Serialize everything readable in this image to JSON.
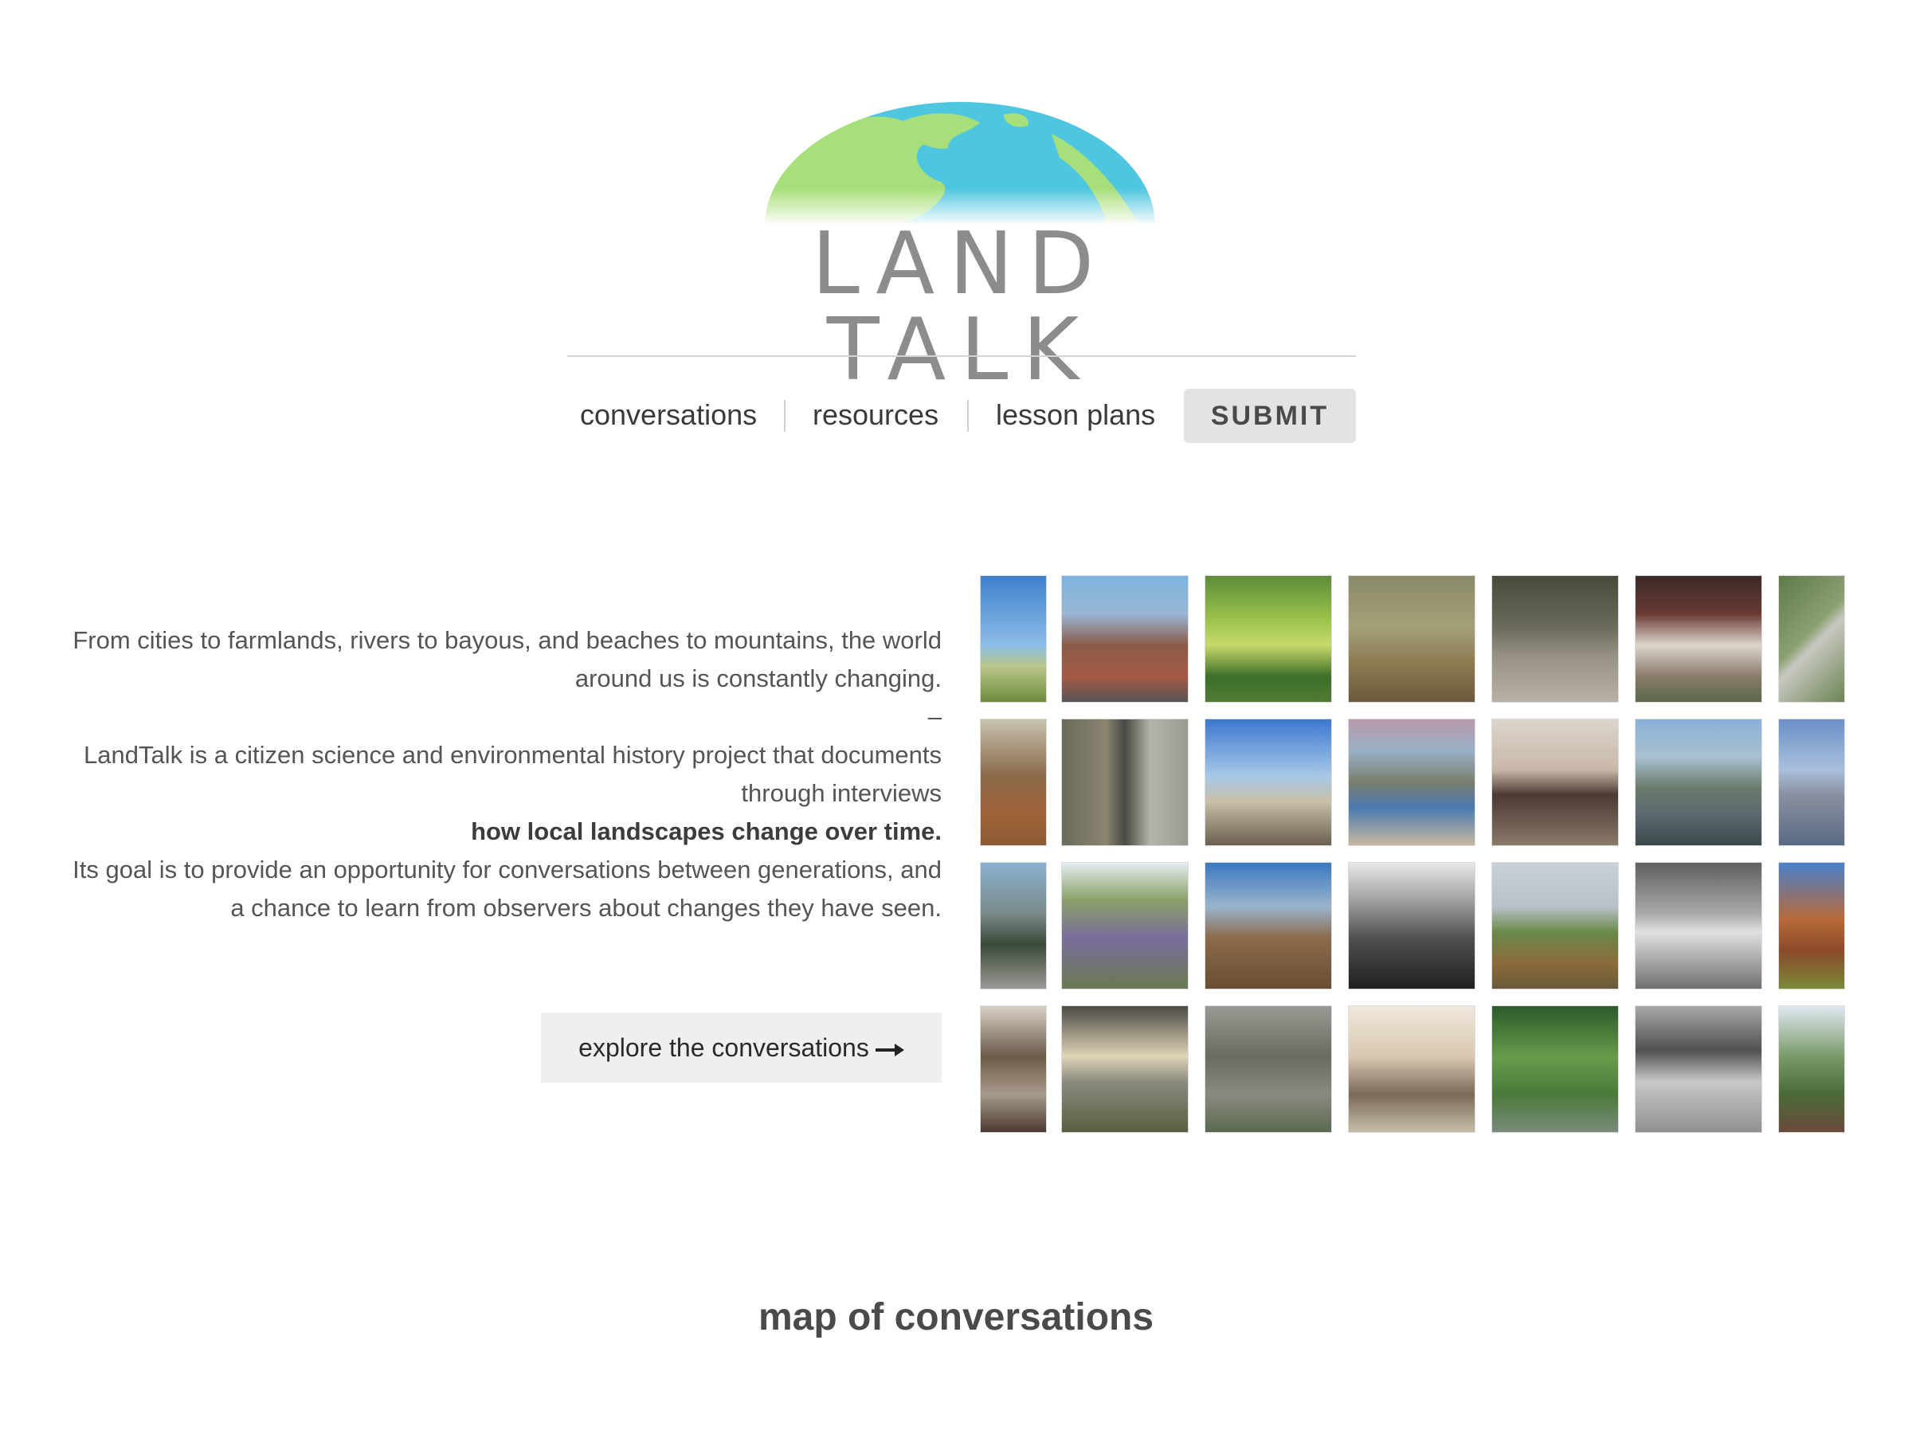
{
  "logo": {
    "text": "LAND TALK",
    "icon": "globe-icon",
    "colors": {
      "ocean": "#4fc6df",
      "land": "#a7df7a",
      "text": "#8c8c8c"
    }
  },
  "nav": {
    "items": [
      {
        "label": "conversations"
      },
      {
        "label": "resources"
      },
      {
        "label": "lesson plans"
      }
    ],
    "submit_label": "SUBMIT"
  },
  "intro": {
    "line1": "From cities to farmlands, rivers to bayous, and beaches to mountains, the world around us is constantly changing.",
    "dash": "–",
    "line2": "LandTalk is a citizen science and environmental history project that documents through interviews",
    "highlight": "how local landscapes change over time.",
    "line3": "Its goal is to provide an opportunity for conversations between generations, and a chance to learn from observers about changes they have seen."
  },
  "explore_button": {
    "label": "explore the conversations"
  },
  "map": {
    "title": "map of conversations"
  },
  "gallery": {
    "rows": [
      [
        {
          "bg": "linear-gradient(to bottom,#3f7fcc 0%,#8cbde8 55%,#b9c78a 72%,#6e8b3d 100%)"
        },
        {
          "bg": "linear-gradient(to bottom,#7cb4e0 0%,#9ab7d4 30%,#8a5a4a 55%,#a45a46 80%,#555 100%)"
        },
        {
          "bg": "linear-gradient(to bottom,#5c8c3a 0%,#9cc44c 35%,#c7d86a 55%,#3e6e2a 80%,#4f7c34 100%)"
        },
        {
          "bg": "linear-gradient(to bottom,#8a8a6a 0%,#a4a078 40%,#8c7a52 70%,#6a5a3a 100%)"
        },
        {
          "bg": "linear-gradient(to bottom,#4a4a3a 0%,#6a6a5a 40%,#9a9488 65%,#b8b0a4 100%)"
        },
        {
          "bg": "linear-gradient(to bottom,#3a2a26 0%,#6a3a34 30%,#ddd6cc 55%,#8a7a6a 80%,#5a6a4a 100%)"
        },
        {
          "bg": "linear-gradient(135deg,#5f7a4a 0%,#8aa070 45%,#c8c8c0 55%,#6a8454 100%)"
        }
      ],
      [
        {
          "bg": "linear-gradient(to bottom,#c8c2b0 0%,#8a6a4a 45%,#a0643a 75%,#8a5a32 100%)"
        },
        {
          "bg": "linear-gradient(to right,#6a6a5a 0%,#8a8470 35%,#4a4a44 50%,#b4b4aa 70%,#9a9a92 100%)"
        },
        {
          "bg": "linear-gradient(to bottom,#3c78d0 0%,#a8c8e8 45%,#c8c0a8 65%,#6a6050 100%)"
        },
        {
          "bg": "linear-gradient(to bottom,#b89aa8 0%,#9ab0c8 25%,#7a7e6e 50%,#4a7ab0 70%,#c8b8a0 100%)"
        },
        {
          "bg": "linear-gradient(to bottom,#dcd4cc 0%,#c8b8a8 40%,#4a3a34 60%,#8a7a6a 100%)"
        },
        {
          "bg": "linear-gradient(to bottom,#8ab0d8 0%,#a8c0d0 30%,#6a7a6a 55%,#5a6a70 75%,#3a4a4a 100%)"
        },
        {
          "bg": "linear-gradient(to bottom,#6a90c8 0%,#aac0dc 40%,#8a90a0 60%,#5a6a84 100%)"
        }
      ],
      [
        {
          "bg": "linear-gradient(to bottom,#8ab0d0 0%,#7a8a8a 40%,#3a4a3a 65%,#9a9a94 100%)"
        },
        {
          "bg": "linear-gradient(to bottom,#e4ecf0 0%,#8aa068 30%,#7a6c9a 60%,#6a7a50 100%)"
        },
        {
          "bg": "linear-gradient(to bottom,#3a78c0 0%,#9ab4cc 35%,#8a6a4a 60%,#6a4e34 100%)"
        },
        {
          "bg": "linear-gradient(to bottom,#e8e8e8 0%,#a0a0a0 30%,#505050 60%,#202020 100%)"
        },
        {
          "bg": "linear-gradient(to bottom,#c8d0d8 0%,#b8c0c8 35%,#6a8a4a 55%,#8a6a3a 80%,#6a5a3a 100%)"
        },
        {
          "bg": "linear-gradient(to bottom,#606060 0%,#a8a8a8 40%,#e0e0e0 55%,#707070 100%)"
        },
        {
          "bg": "linear-gradient(to bottom,#4a80c8 0%,#b86a3a 45%,#8a4a2a 70%,#7a8a3a 100%)"
        }
      ],
      [
        {
          "bg": "linear-gradient(to bottom,#d8d0c4 0%,#6a5a4a 40%,#a89a8a 70%,#4a3a30 100%)"
        },
        {
          "bg": "linear-gradient(to bottom,#4a4a44 0%,#e0d4b8 40%,#8a8a80 60%,#5a6040 100%)"
        },
        {
          "bg": "linear-gradient(to bottom,#9a9a94 0%,#6a6a60 40%,#8a8a80 70%,#5a6a50 100%)"
        },
        {
          "bg": "linear-gradient(to bottom,#f0e8dc 0%,#d8c8b0 40%,#7a6a5a 70%,#c8bca8 100%)"
        },
        {
          "bg": "linear-gradient(to bottom,#2a5a2a 0%,#6a9a4a 40%,#4a7a3a 70%,#7a8a7a 100%)"
        },
        {
          "bg": "linear-gradient(to bottom,#a8a8a8 0%,#505050 35%,#c8c8c8 60%,#909090 100%)"
        },
        {
          "bg": "linear-gradient(to bottom,#e0e8f0 0%,#7a9a6a 40%,#4a6a3a 70%,#6a4a3a 100%)"
        }
      ]
    ]
  }
}
